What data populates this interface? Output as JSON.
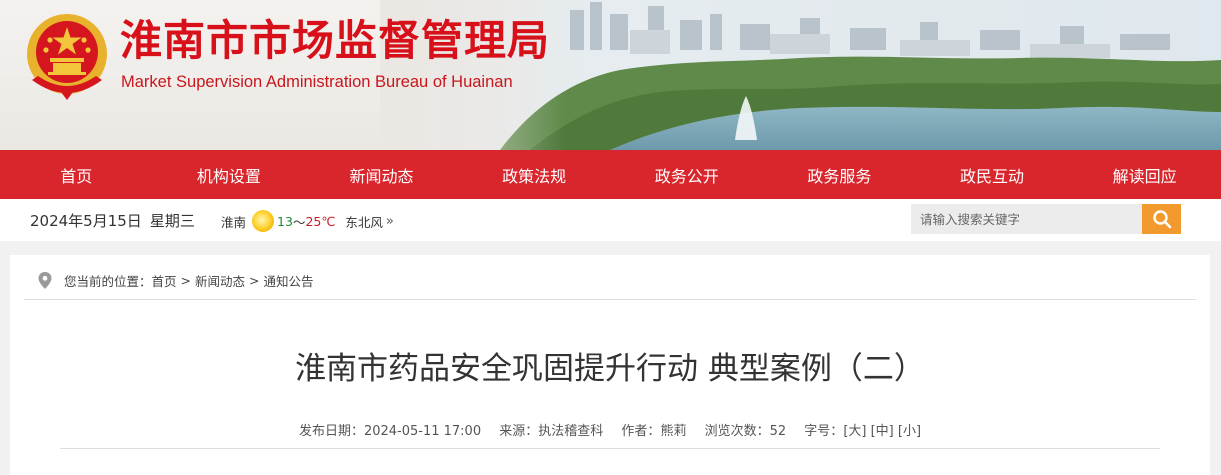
{
  "header": {
    "title": "淮南市市场监督管理局",
    "subtitle": "Market Supervision Administration Bureau of Huainan",
    "emblem_icon": "national-emblem-icon"
  },
  "nav": {
    "items": [
      {
        "label": "首页"
      },
      {
        "label": "机构设置"
      },
      {
        "label": "新闻动态"
      },
      {
        "label": "政策法规"
      },
      {
        "label": "政务公开"
      },
      {
        "label": "政务服务"
      },
      {
        "label": "政民互动"
      },
      {
        "label": "解读回应"
      }
    ]
  },
  "infobar": {
    "date": "2024年5月15日",
    "weekday": "星期三",
    "city": "淮南",
    "weather_icon": "sunny-icon",
    "temp_low": "13",
    "temp_sep": "～",
    "temp_high": "25℃",
    "wind": "东北风",
    "more": "»",
    "search_placeholder": "请输入搜索关键字",
    "search_icon": "search-icon"
  },
  "breadcrumb": {
    "prefix": "您当前的位置：",
    "items": [
      "首页",
      "新闻动态",
      "通知公告"
    ],
    "separator": ">"
  },
  "article": {
    "title": "淮南市药品安全巩固提升行动 典型案例（二）",
    "publish_label": "发布日期：",
    "publish_date": "2024-05-11 17:00",
    "source_label": "来源：",
    "source": "执法稽查科",
    "author_label": "作者：",
    "author": "熊莉",
    "views_label": "浏览次数：",
    "views": "52",
    "fontsize_label": "字号：",
    "fontsize_options": [
      "[大]",
      "[中]",
      "[小]"
    ]
  },
  "colors": {
    "brand_red": "#d9262c",
    "title_red": "#d7101a",
    "search_orange": "#f29a2e"
  }
}
